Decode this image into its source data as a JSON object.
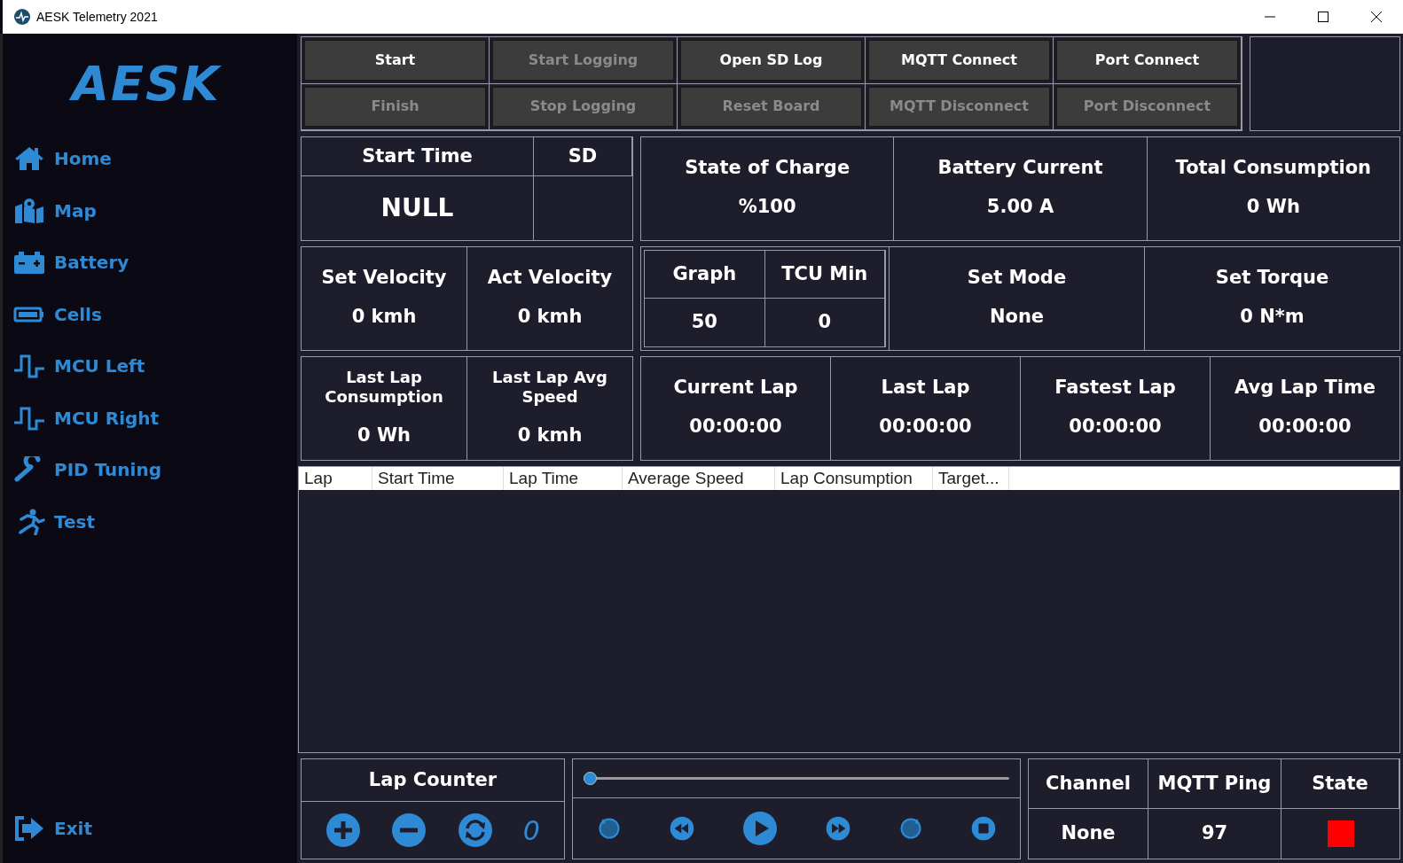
{
  "window": {
    "title": "AESK Telemetry 2021"
  },
  "sidebar": {
    "logo": "AESK",
    "items": [
      {
        "label": "Home"
      },
      {
        "label": "Map"
      },
      {
        "label": "Battery"
      },
      {
        "label": "Cells"
      },
      {
        "label": "MCU Left"
      },
      {
        "label": "MCU Right"
      },
      {
        "label": "PID Tuning"
      },
      {
        "label": "Test"
      }
    ],
    "exit": {
      "label": "Exit"
    }
  },
  "buttons": [
    [
      {
        "label": "Start",
        "disabled": false
      },
      {
        "label": "Start Logging",
        "disabled": true
      },
      {
        "label": "Open SD Log",
        "disabled": false
      },
      {
        "label": "MQTT Connect",
        "disabled": false
      },
      {
        "label": "Port Connect",
        "disabled": false
      }
    ],
    [
      {
        "label": "Finish",
        "disabled": true
      },
      {
        "label": "Stop Logging",
        "disabled": true
      },
      {
        "label": "Reset Board",
        "disabled": true
      },
      {
        "label": "MQTT Disconnect",
        "disabled": true
      },
      {
        "label": "Port Disconnect",
        "disabled": true
      }
    ]
  ],
  "rows": [
    {
      "left": [
        {
          "label": "Start Time",
          "value": "NULL"
        },
        {
          "label": "SD"
        }
      ],
      "inner": [],
      "right": [
        {
          "label": "State of Charge",
          "value": "%100"
        },
        {
          "label": "Battery Current",
          "value": "5.00 A"
        },
        {
          "label": "Total Consumption",
          "value": "0 Wh"
        }
      ]
    },
    {
      "left": [
        {
          "label": "Set Velocity",
          "value": "0 kmh"
        },
        {
          "label": "Act Velocity",
          "value": "0 kmh"
        }
      ],
      "inner": [
        {
          "label": "Graph",
          "value": "50"
        },
        {
          "label": "TCU Min",
          "value": "0"
        }
      ],
      "right": [
        {
          "label": "Set Mode",
          "value": "None"
        },
        {
          "label": "Set Torque",
          "value": "0 N*m"
        }
      ]
    },
    {
      "left": [
        {
          "label": "Last Lap Consumption",
          "value": "0 Wh"
        },
        {
          "label": "Last Lap Avg Speed",
          "value": "0 kmh"
        }
      ],
      "inner": [],
      "right": [
        {
          "label": "Current Lap",
          "value": "00:00:00"
        },
        {
          "label": "Last Lap",
          "value": "00:00:00"
        },
        {
          "label": "Fastest Lap",
          "value": "00:00:00"
        },
        {
          "label": "Avg Lap Time",
          "value": "00:00:00"
        }
      ]
    }
  ],
  "table": {
    "columns": [
      "Lap",
      "Start Time",
      "Lap Time",
      "Average Speed",
      "Lap Consumption",
      "Target..."
    ]
  },
  "lap_counter": {
    "title": "Lap Counter",
    "count": "0"
  },
  "player": {
    "level": 0
  },
  "status": {
    "columns": [
      "Channel",
      "MQTT Ping",
      "State"
    ],
    "channel": "None",
    "ping": "97",
    "state": {
      "color": "#ff0000"
    }
  }
}
